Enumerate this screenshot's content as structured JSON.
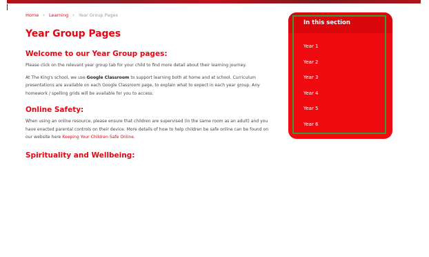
{
  "breadcrumb": {
    "home": "Home",
    "separator": "›",
    "learning": "Learning",
    "current": "Year Group Pages"
  },
  "page_title": "Year Group Pages",
  "welcome": {
    "heading": "Welcome to our Year Group pages:",
    "intro": "Please click on the relevant year group tab for your child to find more detail about their learning journey.",
    "p2_before": "At The King's school, we use ",
    "p2_bold": "Google Classroom",
    "p2_after": " to support learning both at home and at school. Curriculum presentations are available on each Google Classroom page, to explain what to expect in each year group. Any homework / spelling grids will be available for you to access."
  },
  "online_safety": {
    "heading": "Online Safety:",
    "text": "When using an online resource, please ensure that children are supervised (in the same room as an adult) and you have enacted parental controls on their device. More details of how to help children be safe online can be found on our website here ",
    "link": "Keeping Your Children Safe Online",
    "end": "."
  },
  "spirituality": {
    "heading": "Spirituality and Wellbeing:"
  },
  "sidebar": {
    "title": "In this section",
    "items": [
      "Year 1",
      "Year 2",
      "Year 3",
      "Year 4",
      "Year 5",
      "Year 6"
    ]
  },
  "colors": {
    "brand_red": "#e30613",
    "sidebar_bg": "#ee0a0f",
    "highlight_green": "#3a9a38"
  }
}
